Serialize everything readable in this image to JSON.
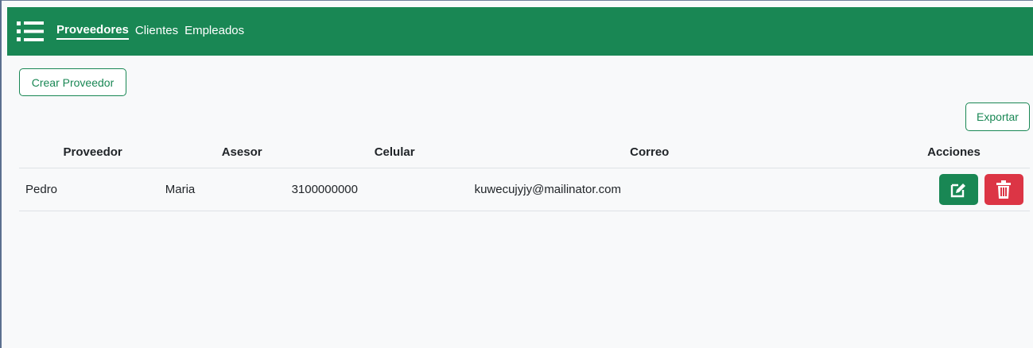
{
  "navbar": {
    "menu_icon": "hamburger-list-icon",
    "links": [
      {
        "label": "Proveedores",
        "active": true
      },
      {
        "label": "Clientes",
        "active": false
      },
      {
        "label": "Empleados",
        "active": false
      }
    ],
    "bg_color": "#198754"
  },
  "toolbar": {
    "create_label": "Crear Proveedor",
    "export_label": "Exportar"
  },
  "table": {
    "headers": [
      "Proveedor",
      "Asesor",
      "Celular",
      "Correo",
      "Acciones"
    ],
    "rows": [
      {
        "proveedor": "Pedro",
        "asesor": "Maria",
        "celular": "3100000000",
        "correo": "kuwecujyjy@mailinator.com",
        "actions": [
          {
            "icon": "edit-icon",
            "color": "#198754"
          },
          {
            "icon": "trash-icon",
            "color": "#dc3545"
          }
        ]
      }
    ]
  }
}
